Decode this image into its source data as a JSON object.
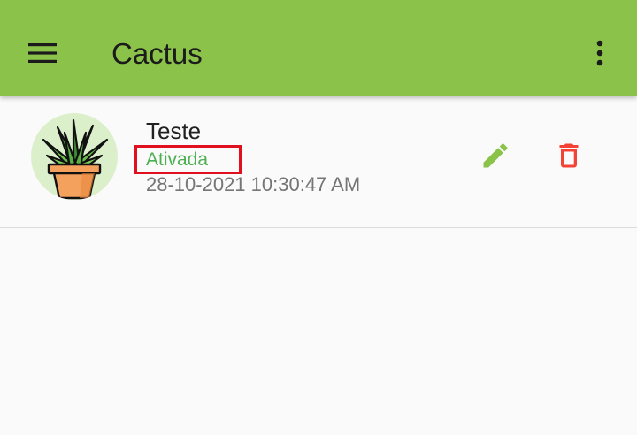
{
  "app_bar": {
    "title": "Cactus",
    "background_color": "#8bc34a",
    "menu_icon": "menu-icon",
    "overflow_icon": "more-vert-icon"
  },
  "plants": [
    {
      "name": "Teste",
      "status": "Ativada",
      "status_color": "#4caf50",
      "datetime": "28-10-2021 10:30:47 AM",
      "avatar_icon": "potted-plant-icon",
      "edit_icon": "pencil-icon",
      "edit_color": "#8bc34a",
      "delete_icon": "trash-icon",
      "delete_color": "#f44336"
    }
  ]
}
